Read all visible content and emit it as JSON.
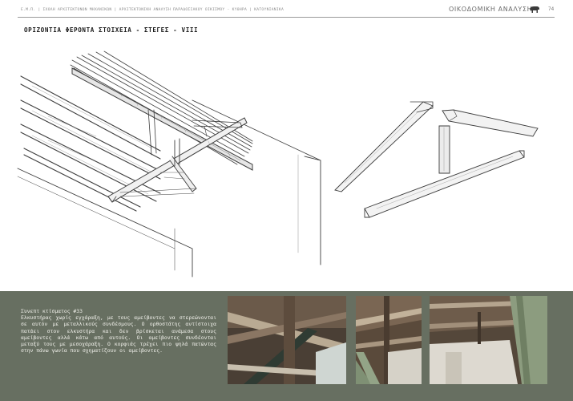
{
  "header": {
    "path": "Ε.Μ.Π. | ΣΧΟΛΗ ΑΡΧΙΤΕΚΤΟΝΩΝ ΜΗΧΑΝΙΚΩΝ | ΑΡΧΙΤΕΚΤΟΝΙΚΗ ΑΝΑΛΥΣΗ ΠΑΡΑΔΟΣΙΑΚΟΥ ΟΙΚΙΣΜΟΥ - ΚΥΘΗΡΑ | ΚΑΤΟΥΝΙΑΝΙΚΑ",
    "section": "ΟΙΚΟΔΟΜΙΚΗ ΑΝΑΛΥΣΗ",
    "page_number": "74",
    "icon": "animal-icon"
  },
  "title": "ΟΡΙΖΟΝΤΙΑ ΦΕΡΟΝΤΑ ΣΤΟΙΧΕΙΑ - ΣΤΕΓΕΣ - VIII",
  "caption": {
    "title": "Συνεπτ κτίσματος #33",
    "body": "Ελκυστήρας χωρίς εγχάραξη, με τους αμείβοντες να στερεώνονται σε αυτόν με μεταλλικούς συνδέσμους. Ο ορθοστάτης αντίστοιχα πατάει στον ελκυστήρα και δεν βρίσκεται ανάμεσα στους αμείβοντες αλλά κάτω από αυτούς. Οι αμείβοντες συνδέονται μεταξύ τους με μεσοχάραξη. Ο κορφιάς τρέχει πιο ψηλά πατώντας στην πάνω γωνία που σχηματίζουν οι αμείβοντες."
  },
  "colors": {
    "panel": "#676f61",
    "caption_text": "#f0f0ea",
    "header_text": "#8a8a8a"
  }
}
